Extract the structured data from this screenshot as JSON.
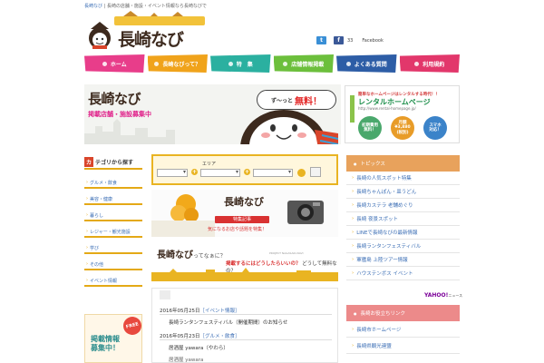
{
  "header": {
    "top_link": "長崎なび",
    "top_separator": " | ",
    "top_text": "長崎の店舗・施設・イベント情報なら長崎なびで",
    "logo_text": "長崎なび"
  },
  "social": {
    "fb_count": "33",
    "facebook_label": "Facebook"
  },
  "nav": [
    {
      "label": "ホーム",
      "color": "#e83d8a"
    },
    {
      "label": "長崎なびって？",
      "color": "#f0a31b"
    },
    {
      "label": "特　集",
      "color": "#2bb0a0"
    },
    {
      "label": "店舗情報掲載",
      "color": "#6cbf3c"
    },
    {
      "label": "よくある質問",
      "color": "#2d5da6"
    },
    {
      "label": "利用規約",
      "color": "#e2376b"
    }
  ],
  "hero": {
    "title": "長崎なび",
    "subtitle": "掲載店舗・施設募集中",
    "bubble_prefix": "ず〜っと",
    "bubble_highlight": "無料！"
  },
  "ad": {
    "line1": "簡単なホームページはレンタルする時代！！",
    "title": "レンタルホームページ",
    "url": "http://www.rental-homepage.jp/",
    "circles": [
      {
        "text": "初期費用\n無料！",
        "color": "#4aa86c"
      },
      {
        "text": "月額\n¥3,880\n(税別)",
        "color": "#e89c28"
      },
      {
        "text": "スマホ\n対応！",
        "color": "#3b83c9"
      }
    ]
  },
  "sidebar": {
    "heading_mark": "カ",
    "heading": "テゴリから探す",
    "categories": [
      "グルメ・飲食",
      "美容・健康",
      "暮らし",
      "レジャー・観光施設",
      "学び",
      "その他",
      "イベント情報"
    ],
    "recruit_text": "掲載情報\n募集中！",
    "free_tag": "FREE"
  },
  "search": {
    "area_label": "エリア"
  },
  "feature": {
    "logo": "長崎なび",
    "banner": "特集記事",
    "caption": "気になるお店や話題を特集！"
  },
  "about": {
    "title": "長崎なび",
    "title_suffix": "ってなぁに？",
    "project": "PROJECT NAGASAKI-NAVI",
    "question_prefix": "掲載するにはどうしたらいいの？",
    "question_suffix": "どうして無料なの？"
  },
  "news": [
    {
      "date": "2016年05月25日",
      "category": "［イベント情報］",
      "title": "長崎ランタンフェスティバル（開催期間）のお知らせ"
    },
    {
      "date": "2016年05月23日",
      "category": "［グルメ・飲食］",
      "title": "居酒屋 yawara（やわら）"
    },
    {
      "date": "",
      "category": "",
      "title": "居酒屋 yawara"
    }
  ],
  "topics": {
    "heading": "トピックス",
    "items": [
      "長崎の人気スポット特集",
      "長崎ちゃんぽん・皿うどん",
      "長崎カステラ 老舗めぐり",
      "長崎 夜景スポット",
      "LINEで長崎なびの最新情報",
      "長崎ランタンフェスティバル",
      "軍艦島 上陸ツアー情報",
      "ハウステンボス イベント"
    ],
    "source": "YAHOO!",
    "source_suffix": "ニュース"
  },
  "links": {
    "heading": "長崎お役立ちリンク",
    "items": [
      "長崎市ホームページ",
      "長崎県観光連盟"
    ]
  }
}
